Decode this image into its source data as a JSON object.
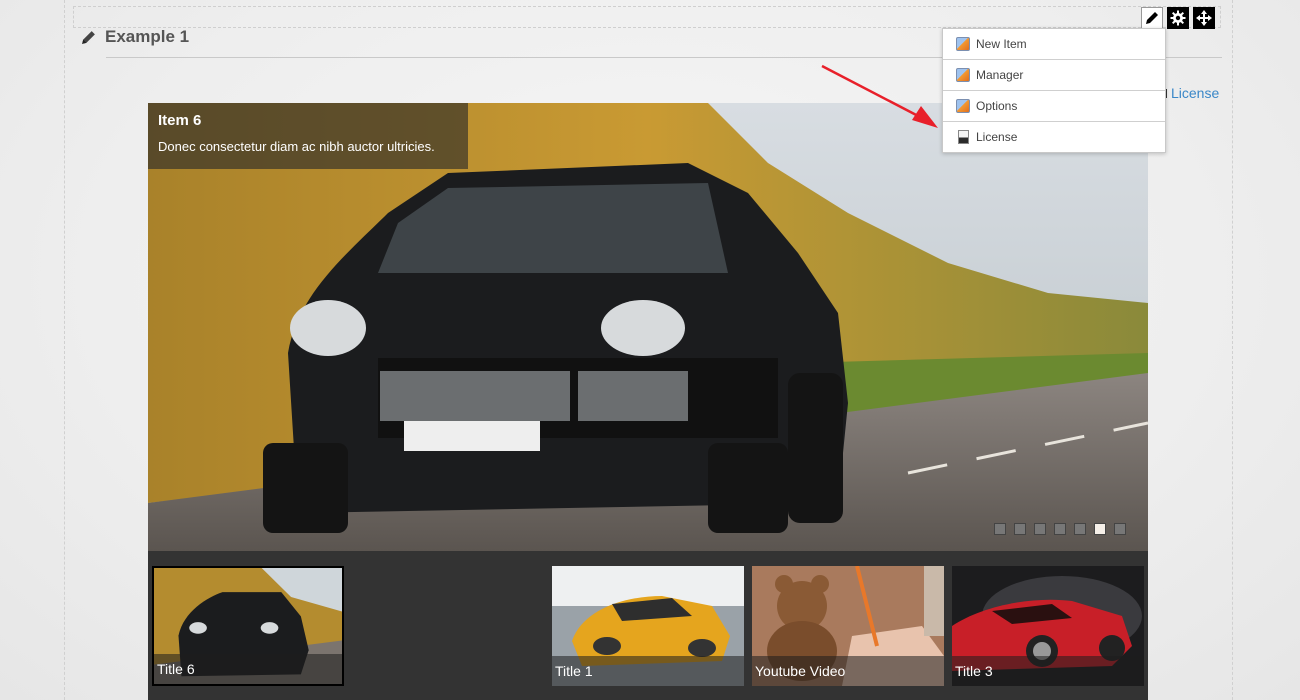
{
  "module": {
    "title": "Example 1",
    "license_link": "License"
  },
  "toolbar": {
    "edit_icon": "pencil-icon",
    "settings_icon": "gear-icon",
    "move_icon": "move-arrows-icon"
  },
  "dropdown": {
    "items": [
      {
        "label": "New Item",
        "icon": "app-icon"
      },
      {
        "label": "Manager",
        "icon": "app-icon"
      },
      {
        "label": "Options",
        "icon": "app-icon"
      },
      {
        "label": "License",
        "icon": "license-icon"
      }
    ]
  },
  "slider": {
    "caption_title": "Item 6",
    "caption_text": "Donec consectetur diam ac nibh auctor ultricies.",
    "bullet_count": 7,
    "active_bullet": 6
  },
  "thumbnails": [
    {
      "label": "Title 6",
      "active": true
    },
    {
      "label": "Title 1",
      "active": false
    },
    {
      "label": "Youtube Video",
      "active": false
    },
    {
      "label": "Title 3",
      "active": false
    }
  ],
  "colors": {
    "link": "#3a87c8",
    "arrow": "#e8202a",
    "thumbstrip": "#333333"
  }
}
